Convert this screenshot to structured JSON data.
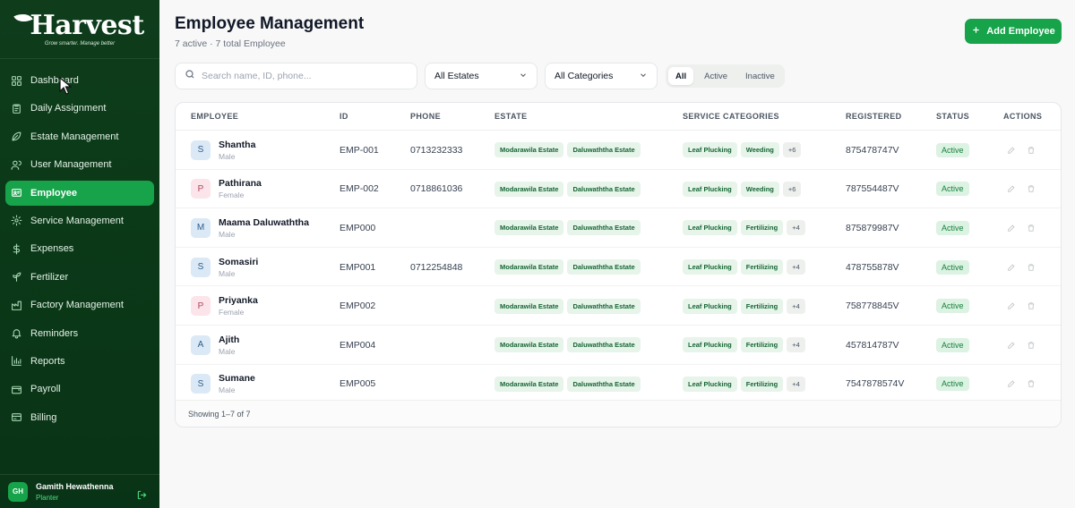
{
  "brand": {
    "name": "arvest",
    "tagline": "Grow smarter. Manage better"
  },
  "sidebar": {
    "items": [
      {
        "label": "Dashboard",
        "icon": "grid-icon"
      },
      {
        "label": "Daily Assignment",
        "icon": "clipboard-icon"
      },
      {
        "label": "Estate Management",
        "icon": "leaf-icon"
      },
      {
        "label": "User Management",
        "icon": "users-icon"
      },
      {
        "label": "Employee",
        "icon": "id-card-icon"
      },
      {
        "label": "Service Management",
        "icon": "gear-icon"
      },
      {
        "label": "Expenses",
        "icon": "dollar-icon"
      },
      {
        "label": "Fertilizer",
        "icon": "sprout-icon"
      },
      {
        "label": "Factory Management",
        "icon": "factory-icon"
      },
      {
        "label": "Reminders",
        "icon": "bell-icon"
      },
      {
        "label": "Reports",
        "icon": "bar-chart-icon"
      },
      {
        "label": "Payroll",
        "icon": "wallet-icon"
      },
      {
        "label": "Billing",
        "icon": "billing-icon"
      }
    ],
    "active_index": 4,
    "user": {
      "initials": "GH",
      "name": "Gamith Hewathenna",
      "role": "Planter"
    }
  },
  "header": {
    "title": "Employee Management",
    "subtitle": "7 active · 7 total Employee",
    "add_label": "Add Employee"
  },
  "filters": {
    "search_placeholder": "Search name, ID, phone...",
    "estates": "All Estates",
    "categories": "All Categories",
    "segments": [
      "All",
      "Active",
      "Inactive"
    ],
    "active_segment": "All"
  },
  "table": {
    "columns": [
      "EMPLOYEE",
      "ID",
      "PHONE",
      "ESTATE",
      "SERVICE CATEGORIES",
      "REGISTERED",
      "STATUS",
      "ACTIONS"
    ],
    "rows": [
      {
        "initial": "S",
        "name": "Shantha",
        "gender": "Male",
        "id": "EMP-001",
        "phone": "0713232333",
        "estates": [
          "Modarawila Estate",
          "Daluwaththa Estate"
        ],
        "cats": [
          "Leaf Plucking",
          "Weeding"
        ],
        "more": "+6",
        "registered": "875478747V",
        "status": "Active"
      },
      {
        "initial": "P",
        "name": "Pathirana",
        "gender": "Female",
        "id": "EMP-002",
        "phone": "0718861036",
        "estates": [
          "Modarawila Estate",
          "Daluwaththa Estate"
        ],
        "cats": [
          "Leaf Plucking",
          "Weeding"
        ],
        "more": "+6",
        "registered": "787554487V",
        "status": "Active"
      },
      {
        "initial": "M",
        "name": "Maama Daluwaththa",
        "gender": "Male",
        "id": "EMP000",
        "phone": "",
        "estates": [
          "Modarawila Estate",
          "Daluwaththa Estate"
        ],
        "cats": [
          "Leaf Plucking",
          "Fertilizing"
        ],
        "more": "+4",
        "registered": "875879987V",
        "status": "Active"
      },
      {
        "initial": "S",
        "name": "Somasiri",
        "gender": "Male",
        "id": "EMP001",
        "phone": "0712254848",
        "estates": [
          "Modarawila Estate",
          "Daluwaththa Estate"
        ],
        "cats": [
          "Leaf Plucking",
          "Fertilizing"
        ],
        "more": "+4",
        "registered": "478755878V",
        "status": "Active"
      },
      {
        "initial": "P",
        "name": "Priyanka",
        "gender": "Female",
        "id": "EMP002",
        "phone": "",
        "estates": [
          "Modarawila Estate",
          "Daluwaththa Estate"
        ],
        "cats": [
          "Leaf Plucking",
          "Fertilizing"
        ],
        "more": "+4",
        "registered": "758778845V",
        "status": "Active"
      },
      {
        "initial": "A",
        "name": "Ajith",
        "gender": "Male",
        "id": "EMP004",
        "phone": "",
        "estates": [
          "Modarawila Estate",
          "Daluwaththa Estate"
        ],
        "cats": [
          "Leaf Plucking",
          "Fertilizing"
        ],
        "more": "+4",
        "registered": "457814787V",
        "status": "Active"
      },
      {
        "initial": "S",
        "name": "Sumane",
        "gender": "Male",
        "id": "EMP005",
        "phone": "",
        "estates": [
          "Modarawila Estate",
          "Daluwaththa Estate"
        ],
        "cats": [
          "Leaf Plucking",
          "Fertilizing"
        ],
        "more": "+4",
        "registered": "7547878574V",
        "status": "Active"
      }
    ],
    "footer": "Showing 1–7 of 7"
  },
  "colors": {
    "brand_green": "#16a34a",
    "sidebar_bg": "#0f3d1c"
  }
}
